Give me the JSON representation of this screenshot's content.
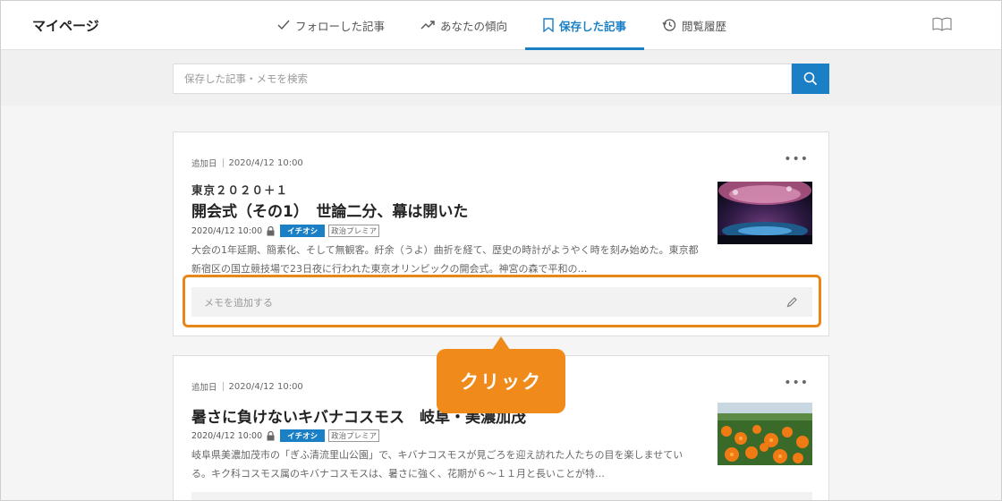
{
  "header": {
    "title": "マイページ",
    "tabs": [
      {
        "label": "フォローした記事",
        "icon": "check-icon"
      },
      {
        "label": "あなたの傾向",
        "icon": "trend-icon"
      },
      {
        "label": "保存した記事",
        "icon": "bookmark-icon",
        "active": true
      },
      {
        "label": "閲覧履歴",
        "icon": "history-icon"
      }
    ],
    "right_icon": "book-icon"
  },
  "search": {
    "placeholder": "保存した記事・メモを検索"
  },
  "articles": [
    {
      "added_label": "追加日",
      "added_date": "2020/4/12 10:00",
      "kicker": "東京２０２０＋１",
      "title": "開会式（その1）　世論二分、幕は開いた",
      "published": "2020/4/12 10:00",
      "badge_primary": "イチオシ",
      "badge_secondary": "政治プレミア",
      "summary": "大会の1年延期、簡素化、そして無観客。紆余（うよ）曲折を経て、歴史の時計がようやく時を刻み始めた。東京都新宿区の国立競技場で23日夜に行われた東京オリンピックの開会式。神宮の森で平和の…",
      "memo_placeholder": "メモを追加する"
    },
    {
      "added_label": "追加日",
      "added_date": "2020/4/12 10:00",
      "title": "暑さに負けないキバナコスモス　岐阜・美濃加茂",
      "published": "2020/4/12 10:00",
      "badge_primary": "イチオシ",
      "badge_secondary": "政治プレミア",
      "summary": "岐阜県美濃加茂市の「ぎふ清流里山公園」で、キバナコスモスが見ごろを迎え訪れた人たちの目を楽しませている。キク科コスモス属のキバナコスモスは、暑さに強く、花期が６～１１月と長いことが特…"
    }
  ],
  "callout": {
    "label": "クリック"
  },
  "colors": {
    "accent": "#1a7fc4",
    "highlight": "#ef8a1b"
  }
}
